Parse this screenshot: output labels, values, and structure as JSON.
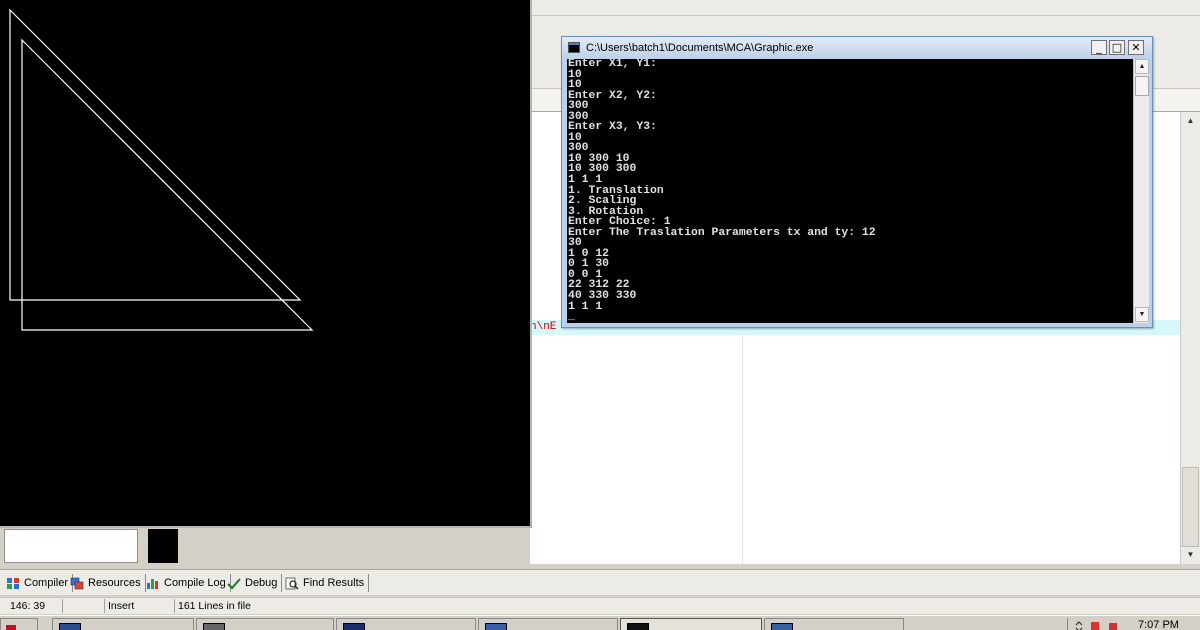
{
  "console": {
    "title": "C:\\Users\\batch1\\Documents\\MCA\\Graphic.exe",
    "minimize_glyph": "_",
    "maximize_glyph": "□",
    "close_glyph": "✕",
    "output_lines": [
      "Enter X1, Y1:",
      "10",
      "10",
      "Enter X2, Y2:",
      "300",
      "300",
      "Enter X3, Y3:",
      "10",
      "300",
      "10 300 10",
      "10 300 300",
      "1 1 1",
      "1. Translation",
      "2. Scaling",
      "3. Rotation",
      "Enter Choice: 1",
      "Enter The Traslation Parameters tx and ty: 12",
      "30",
      "1 0 12",
      "0 1 30",
      "0 0 1",
      "22 312 22",
      "40 330 330",
      "1 1 1",
      "_"
    ]
  },
  "graphics": {
    "stroke_color": "#ffffff",
    "original_triangle": {
      "x": [
        10,
        300,
        10
      ],
      "y": [
        10,
        300,
        300
      ]
    },
    "translated_triangle": {
      "x": [
        22,
        312,
        22
      ],
      "y": [
        40,
        330,
        330
      ]
    }
  },
  "editor": {
    "code_fragment": "n\\nE"
  },
  "bottom_tabs": [
    {
      "label": "Compiler",
      "icon": "compiler-icon"
    },
    {
      "label": "Resources",
      "icon": "resources-icon"
    },
    {
      "label": "Compile Log",
      "icon": "compile-log-icon"
    },
    {
      "label": "Debug",
      "icon": "debug-check-icon"
    },
    {
      "label": "Find Results",
      "icon": "find-results-icon"
    }
  ],
  "status": {
    "position": "146: 39",
    "mode": "Insert",
    "lines": "161 Lines in file"
  },
  "taskbar": {
    "clock": "7:07 PM"
  }
}
